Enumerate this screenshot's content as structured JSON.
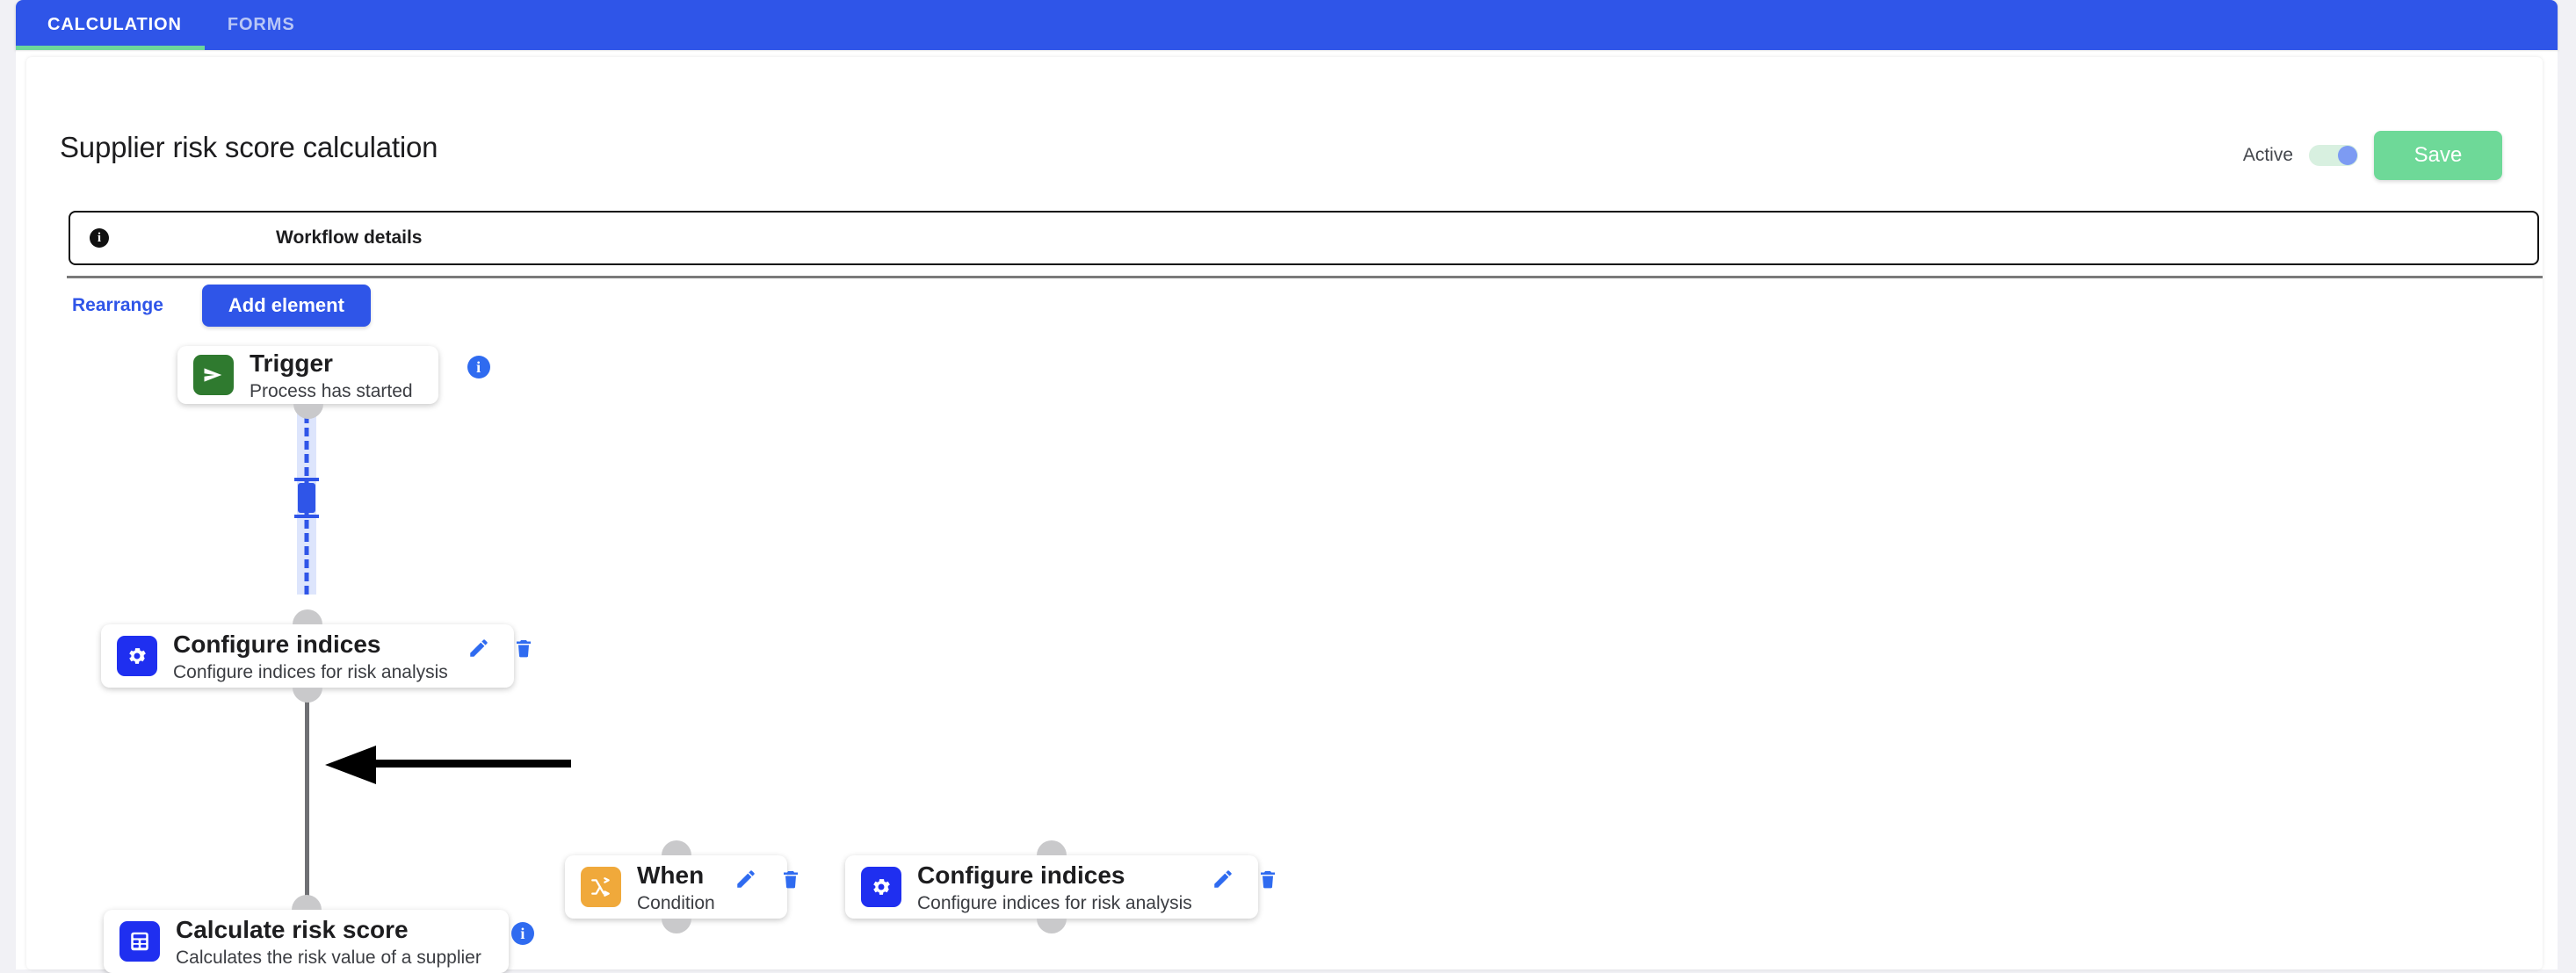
{
  "topbar": {
    "tabs": [
      {
        "label": "CALCULATION",
        "active": true
      },
      {
        "label": "FORMS",
        "active": false
      }
    ],
    "accent_color": "#2f55e8",
    "active_underline_color": "#6dd79a"
  },
  "header": {
    "title": "Supplier risk score calculation",
    "active_label": "Active",
    "active_toggle_on": true,
    "save_label": "Save",
    "save_color": "#6ed998"
  },
  "workflow_details": {
    "icon": "info-icon",
    "label": "Workflow details"
  },
  "toolbar": {
    "rearrange_label": "Rearrange",
    "add_element_label": "Add element"
  },
  "flow": {
    "nodes": [
      {
        "id": "trigger",
        "title": "Trigger",
        "subtitle": "Process has started",
        "icon": "send-icon",
        "icon_color": "#2f7a2f",
        "badge": "info-badge",
        "actions": []
      },
      {
        "id": "configure-indices-1",
        "title": "Configure indices",
        "subtitle": "Configure indices for risk analysis",
        "icon": "gear-icon",
        "icon_color": "#1f2ff0",
        "badge": null,
        "actions": [
          "edit-icon",
          "delete-icon"
        ]
      },
      {
        "id": "when",
        "title": "When",
        "subtitle": "Condition",
        "icon": "branch-icon",
        "icon_color": "#f0a93b",
        "badge": null,
        "actions": [
          "edit-icon",
          "delete-icon"
        ]
      },
      {
        "id": "configure-indices-2",
        "title": "Configure indices",
        "subtitle": "Configure indices for risk analysis",
        "icon": "gear-icon",
        "icon_color": "#1f2ff0",
        "badge": null,
        "actions": [
          "edit-icon",
          "delete-icon"
        ]
      },
      {
        "id": "calculate-risk-score",
        "title": "Calculate risk score",
        "subtitle": "Calculates the risk value of a supplier",
        "icon": "calculator-icon",
        "icon_color": "#1f2ff0",
        "badge": "info-badge",
        "actions": []
      }
    ],
    "connectors": [
      {
        "from": "trigger",
        "to": "configure-indices-1",
        "style": "drop-target-dashed",
        "color": "#2f55e8"
      },
      {
        "from": "configure-indices-1",
        "to": "calculate-risk-score",
        "style": "solid",
        "color": "#6f7074"
      }
    ],
    "annotation": {
      "type": "pointer-arrow",
      "direction": "left",
      "color": "#000000"
    }
  }
}
